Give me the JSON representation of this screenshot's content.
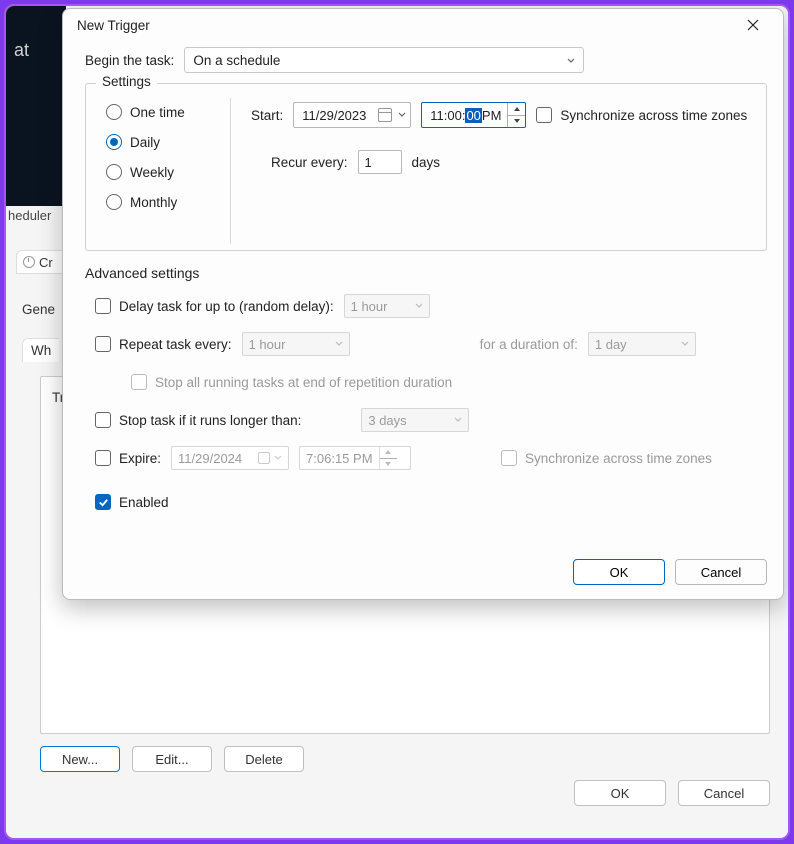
{
  "background": {
    "dark_label": "at",
    "scheduler_truncated": "heduler",
    "cr_tab": "Cr",
    "gene_tab": "Gene",
    "wh_tab": "Wh",
    "tri_label": "Tri",
    "new_btn": "New...",
    "edit_btn": "Edit...",
    "delete_btn": "Delete",
    "parent_ok": "OK",
    "parent_cancel": "Cancel"
  },
  "dialog": {
    "title": "New Trigger",
    "begin_label": "Begin the task:",
    "begin_value": "On a schedule",
    "settings_legend": "Settings",
    "schedule_types": {
      "one_time": "One time",
      "daily": "Daily",
      "weekly": "Weekly",
      "monthly": "Monthly",
      "selected": "daily"
    },
    "start_label": "Start:",
    "start_date": "11/29/2023",
    "start_time_prefix": "11:00:",
    "start_time_selected": "00",
    "start_time_suffix": " PM",
    "sync_tz": "Synchronize across time zones",
    "recur_label": "Recur every:",
    "recur_value": "1",
    "recur_unit": "days",
    "advanced": {
      "heading": "Advanced settings",
      "delay_label": "Delay task for up to (random delay):",
      "delay_value": "1 hour",
      "repeat_label": "Repeat task every:",
      "repeat_value": "1 hour",
      "duration_label": "for a duration of:",
      "duration_value": "1 day",
      "stop_all": "Stop all running tasks at end of repetition duration",
      "stop_if_label": "Stop task if it runs longer than:",
      "stop_if_value": "3 days",
      "expire_label": "Expire:",
      "expire_date": "11/29/2024",
      "expire_time": "7:06:15 PM",
      "expire_sync": "Synchronize across time zones",
      "enabled_label": "Enabled"
    },
    "ok": "OK",
    "cancel": "Cancel"
  }
}
